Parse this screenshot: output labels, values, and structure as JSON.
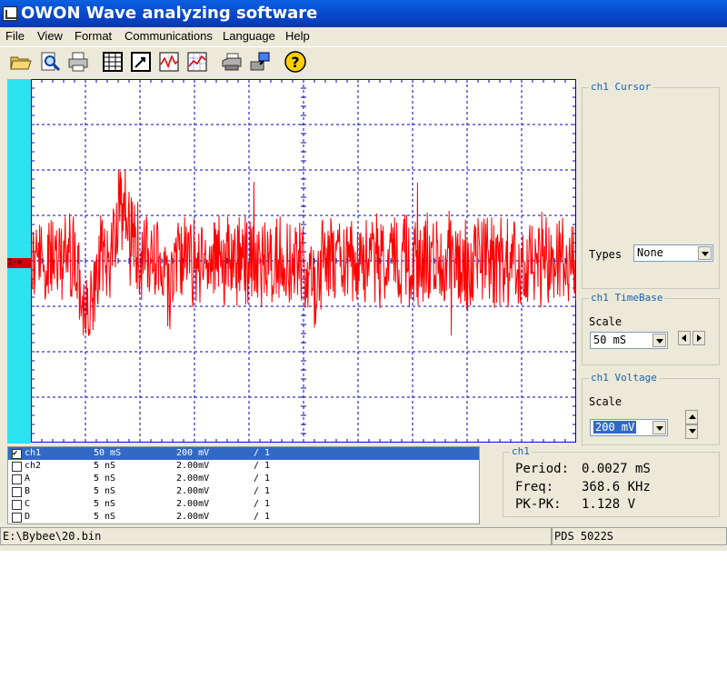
{
  "window": {
    "title": "OWON Wave analyzing software"
  },
  "menu": [
    "File",
    "View",
    "Format",
    "Communications",
    "Language",
    "Help"
  ],
  "toolbar_icons": [
    "open-folder-icon",
    "print-preview-icon",
    "print-icon",
    "table-icon",
    "edit-export-icon",
    "waveform-icon",
    "chart-grid-icon",
    "printer-setup-icon",
    "connect-device-icon",
    "help-icon"
  ],
  "plot": {
    "channel_marker": "1->",
    "trace_color": "#ff0000",
    "grid_color": "#0000c0",
    "left_strip_color": "#2ee3f0"
  },
  "channels": [
    {
      "name": "ch1",
      "timebase": "50 mS",
      "voltage": "200 mV",
      "probe": "/ 1",
      "checked": true,
      "selected": true
    },
    {
      "name": "ch2",
      "timebase": "5 nS",
      "voltage": "2.00mV",
      "probe": "/ 1",
      "checked": false,
      "selected": false
    },
    {
      "name": "A",
      "timebase": "5 nS",
      "voltage": "2.00mV",
      "probe": "/ 1",
      "checked": false,
      "selected": false
    },
    {
      "name": "B",
      "timebase": "5 nS",
      "voltage": "2.00mV",
      "probe": "/ 1",
      "checked": false,
      "selected": false
    },
    {
      "name": "C",
      "timebase": "5 nS",
      "voltage": "2.00mV",
      "probe": "/ 1",
      "checked": false,
      "selected": false
    },
    {
      "name": "D",
      "timebase": "5 nS",
      "voltage": "2.00mV",
      "probe": "/ 1",
      "checked": false,
      "selected": false
    }
  ],
  "cursor_panel": {
    "title": "ch1 Cursor",
    "types_label": "Types",
    "types_value": "None"
  },
  "timebase_panel": {
    "title": "ch1 TimeBase",
    "scale_label": "Scale",
    "scale_value": "50 mS"
  },
  "voltage_panel": {
    "title": "ch1 Voltage",
    "scale_label": "Scale",
    "scale_value": "200 mV"
  },
  "measure_panel": {
    "title": "ch1",
    "period_label": "Period:",
    "period_value": "0.0027 mS",
    "freq_label": "Freq:",
    "freq_value": "368.6 KHz",
    "pkpk_label": "PK-PK:",
    "pkpk_value": "1.128 V"
  },
  "status": {
    "file_path": "E:\\Bybee\\20.bin",
    "device": "PDS 5022S"
  }
}
